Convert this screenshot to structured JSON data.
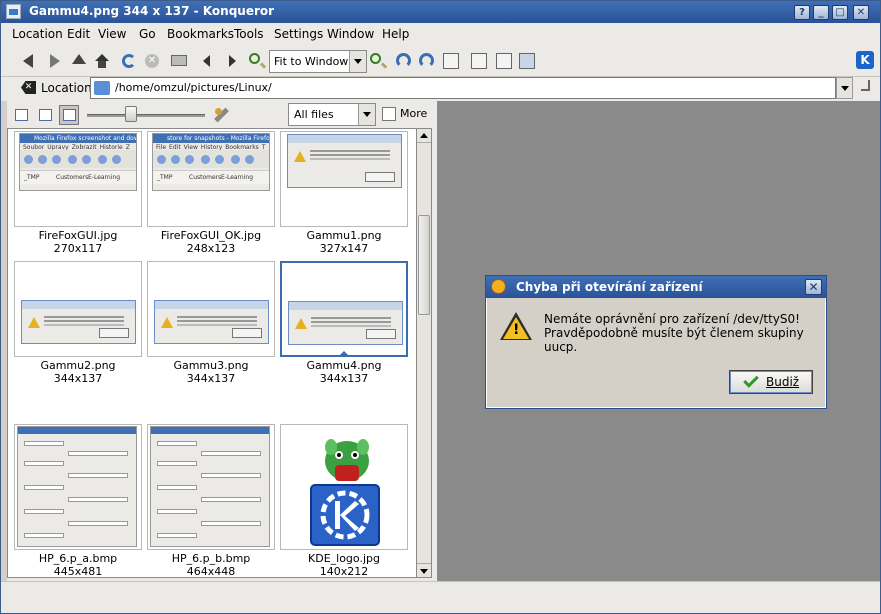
{
  "window": {
    "title": "Gammu4.png 344 x 137 - Konqueror",
    "buttons": [
      "?",
      "_",
      "□",
      "✕"
    ]
  },
  "menubar": {
    "items": [
      {
        "label": "Location"
      },
      {
        "label": "Edit"
      },
      {
        "label": "View"
      },
      {
        "label": "Go"
      },
      {
        "label": "Bookmarks"
      },
      {
        "label": "Tools"
      },
      {
        "label": "Settings"
      },
      {
        "label": "Window"
      },
      {
        "label": "Help"
      }
    ]
  },
  "toolbar": {
    "zoom_value": "Fit to Window",
    "icons": [
      "back-icon",
      "forward-icon",
      "up-icon",
      "home-icon",
      "reload-icon",
      "stop-icon",
      "print-icon",
      "prev-image-icon",
      "next-image-icon",
      "zoom-icon",
      "zoom-in-icon",
      "rotate-left-icon",
      "rotate-right-icon",
      "fullscreen-icon",
      "grid-icon",
      "view-mode-icon",
      "preview-icon"
    ]
  },
  "location": {
    "label": "Location:",
    "url": "/home/omzul/pictures/Linux/"
  },
  "viewbar": {
    "filter_value": "All files",
    "more_label": "More",
    "zoom_level": 0.37
  },
  "thumbnails": [
    {
      "name": "FireFoxGUI.jpg",
      "dims": "270x117",
      "kind": "firefox",
      "selected": false,
      "caption": "Mozilla Firefox screenshot and down",
      "menu": [
        "Soubor",
        "Úpravy",
        "Zobrazit",
        "Historie",
        "Z"
      ],
      "bookmarks": [
        "_TMP",
        "Customers",
        "E-Learning"
      ]
    },
    {
      "name": "FireFoxGUI_OK.jpg",
      "dims": "248x123",
      "kind": "firefox",
      "selected": false,
      "caption": "store for snapshots - Mozilla Firefox",
      "menu": [
        "File",
        "Edit",
        "View",
        "History",
        "Bookmarks",
        "T"
      ],
      "bookmarks": [
        "_TMP",
        "Customers",
        "E-Learning"
      ]
    },
    {
      "name": "Gammu1.png",
      "dims": "327x147",
      "kind": "dialog",
      "selected": false
    },
    {
      "name": "Gammu2.png",
      "dims": "344x137",
      "kind": "dialog",
      "selected": false
    },
    {
      "name": "Gammu3.png",
      "dims": "344x137",
      "kind": "dialog",
      "selected": false
    },
    {
      "name": "Gammu4.png",
      "dims": "344x137",
      "kind": "dialog",
      "selected": true
    },
    {
      "name": "HP_6.p_a.bmp",
      "dims": "445x481",
      "kind": "form",
      "selected": false
    },
    {
      "name": "HP_6.p_b.bmp",
      "dims": "464x448",
      "kind": "form",
      "selected": false
    },
    {
      "name": "KDE_logo.jpg",
      "dims": "140x212",
      "kind": "kde",
      "selected": false
    }
  ],
  "dialog": {
    "title": "Chyba při otevírání zařízení",
    "message_line1": "Nemáte oprávnění pro zařízení /dev/ttyS0!",
    "message_line2": "Pravděpodobně musíte být členem skupiny uucp.",
    "ok_label": "Budiž"
  },
  "colors": {
    "titlebar": "#2a5299",
    "viewer_bg": "#8a8a8a",
    "selection": "#3a6cb0"
  }
}
